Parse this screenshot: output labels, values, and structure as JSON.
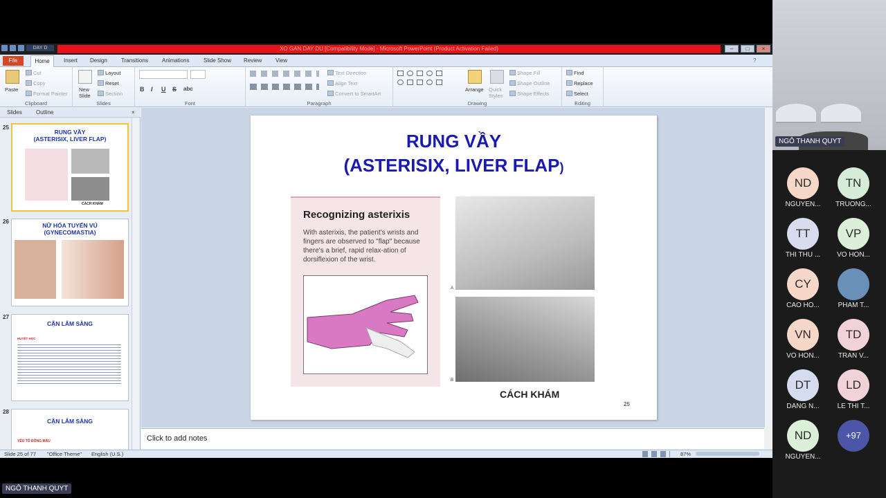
{
  "window": {
    "title": "XO GAN DAY DU [Compatibility Mode] - Microsoft PowerPoint (Product Activation Failed)",
    "qat_doc": "DAY D"
  },
  "ribbon": {
    "tabs": [
      "File",
      "Home",
      "Insert",
      "Design",
      "Transitions",
      "Animations",
      "Slide Show",
      "Review",
      "View"
    ],
    "clipboard": {
      "label": "Clipboard",
      "paste": "Paste",
      "cut": "Cut",
      "copy": "Copy",
      "format_painter": "Format Painter"
    },
    "slides": {
      "label": "Slides",
      "new_slide": "New Slide",
      "layout": "Layout",
      "reset": "Reset",
      "section": "Section"
    },
    "font": {
      "label": "Font",
      "bold": "B",
      "italic": "I",
      "underline": "U",
      "strike": "S",
      "shadow": "abc"
    },
    "paragraph": {
      "label": "Paragraph",
      "text_direction": "Text Direction",
      "align_text": "Align Text",
      "smartart": "Convert to SmartArt"
    },
    "drawing": {
      "label": "Drawing",
      "arrange": "Arrange",
      "quick_styles": "Quick Styles",
      "shape_fill": "Shape Fill",
      "shape_outline": "Shape Outline",
      "shape_effects": "Shape Effects"
    },
    "editing": {
      "label": "Editing",
      "find": "Find",
      "replace": "Replace",
      "select": "Select"
    }
  },
  "left_pane": {
    "tabs": [
      "Slides",
      "Outline"
    ],
    "thumbs": [
      {
        "num": "25",
        "title": "RUNG VẦY\n(ASTERISIX, LIVER FLAP)",
        "caption": "CÁCH KHÁM"
      },
      {
        "num": "26",
        "title": "NỮ HÓA TUYẾN VÚ\n(GYNECOMASTIA)"
      },
      {
        "num": "27",
        "title": "CẬN LÂM SÀNG",
        "subhead": "HUYẾT HỌC"
      },
      {
        "num": "28",
        "title": "CẬN LÂM SÀNG",
        "subhead": "YẾU TỐ ĐÔNG MÁU"
      }
    ]
  },
  "slide": {
    "title_line1": "RUNG VẦY",
    "title_line2": "(ASTERISIX, LIVER FLAP",
    "title_paren": ")",
    "box_heading": "Recognizing asterixis",
    "box_text": "With asterixis, the patient's wrists and fingers are observed to \"flap\" because there's a brief, rapid relax-ation of dorsiflexion of the wrist.",
    "label_a": "A",
    "label_b": "B",
    "caption": "CÁCH KHÁM",
    "number": "25"
  },
  "notes": {
    "placeholder": "Click to add notes"
  },
  "status": {
    "slide": "Slide 25 of 77",
    "theme": "\"Office Theme\"",
    "lang": "English (U.S.)",
    "zoom": "87%"
  },
  "meeting": {
    "speaker": "NGÔ THANH QUYT",
    "participants": [
      {
        "initials": "ND",
        "name": "NGUYEN...",
        "color": "#f6d7c8"
      },
      {
        "initials": "TN",
        "name": "TRUONG...",
        "color": "#d6ecd9"
      },
      {
        "initials": "TT",
        "name": "THI THU ...",
        "color": "#d9dcef"
      },
      {
        "initials": "VP",
        "name": "VO HON...",
        "color": "#dcefd9"
      },
      {
        "initials": "CY",
        "name": "CAO HO...",
        "color": "#f6d7c8"
      },
      {
        "initials": "",
        "name": "PHAM T...",
        "color": "#6a8fb8"
      },
      {
        "initials": "VN",
        "name": "VO HON...",
        "color": "#f6d7c8"
      },
      {
        "initials": "TD",
        "name": "TRAN V...",
        "color": "#f1d2d8"
      },
      {
        "initials": "DT",
        "name": "DANG N...",
        "color": "#d6dcf0"
      },
      {
        "initials": "LD",
        "name": "LE THI T...",
        "color": "#f1d2d8"
      },
      {
        "initials": "ND",
        "name": "NGUYEN...",
        "color": "#dcefd9"
      },
      {
        "initials": "+97",
        "name": "",
        "color": "#4b56a8"
      }
    ]
  }
}
